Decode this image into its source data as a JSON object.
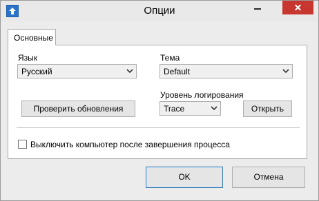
{
  "window": {
    "title": "Опции"
  },
  "tabs": [
    {
      "label": "Основные"
    }
  ],
  "language": {
    "label": "Язык",
    "value": "Русский"
  },
  "theme": {
    "label": "Тема",
    "value": "Default"
  },
  "log_level": {
    "label": "Уровень логирования",
    "value": "Trace"
  },
  "buttons": {
    "check_updates": "Проверить обновления",
    "open": "Открыть",
    "ok": "OK",
    "cancel": "Отмена"
  },
  "shutdown_option": {
    "label": "Выключить компьютер после завершения процесса",
    "checked": false
  },
  "icons": {
    "app": "app-up-arrow-icon",
    "minimize": "minimize-icon",
    "close": "close-icon",
    "dropdown": "chevron-down-icon"
  },
  "colors": {
    "close_button": "#c7372f",
    "app_icon": "#2b73c9",
    "primary_border": "#3c7fb1"
  }
}
